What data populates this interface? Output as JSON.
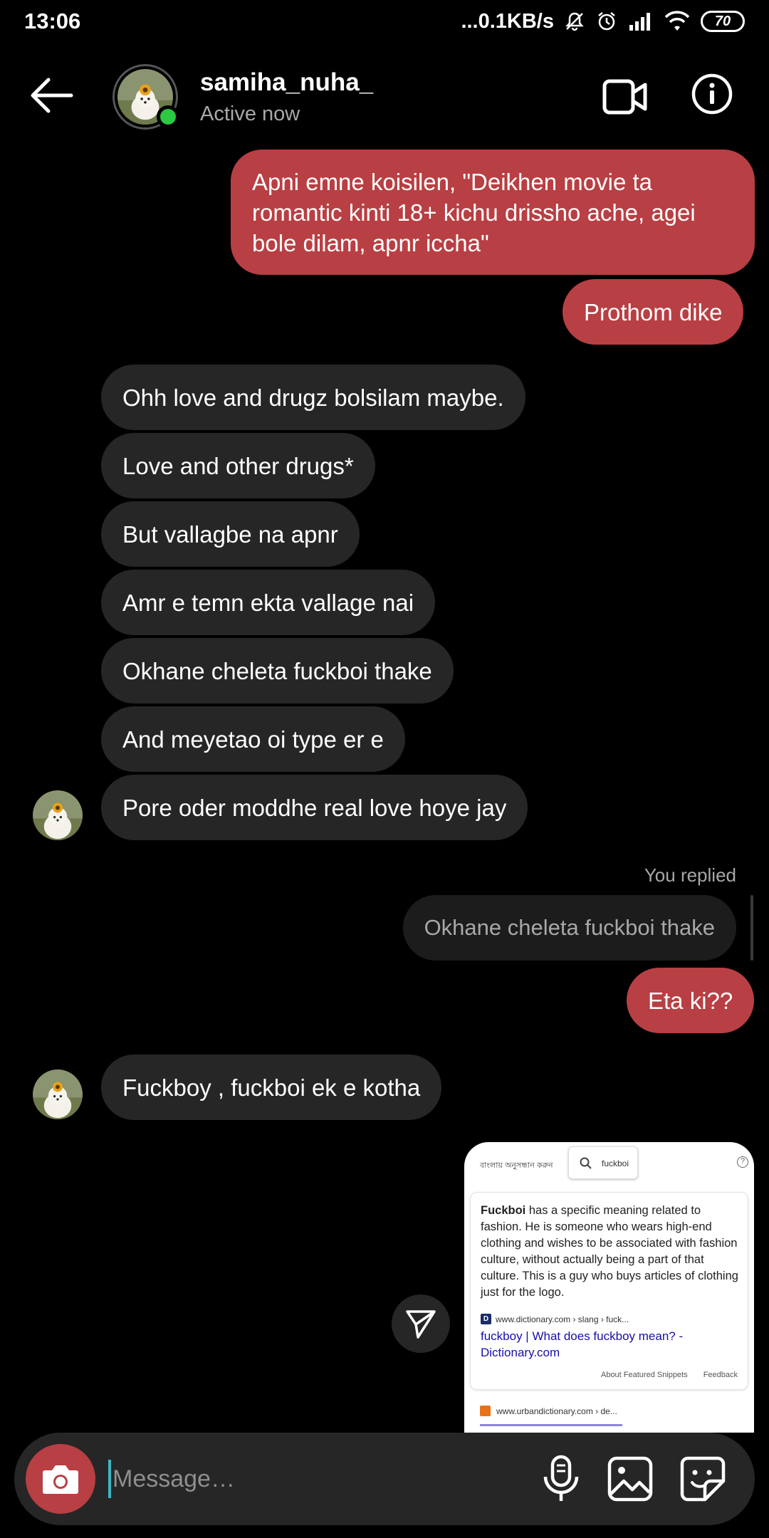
{
  "status_bar": {
    "time": "13:06",
    "net_speed": "...0.1KB/s",
    "battery": "70"
  },
  "header": {
    "username": "samiha_nuha_",
    "status": "Active now"
  },
  "messages": {
    "out1": "Apni emne koisilen, \"Deikhen movie ta romantic kinti 18+ kichu drissho ache, agei bole dilam, apnr iccha\"",
    "out2": "Prothom dike",
    "in1": "Ohh love and drugz bolsilam maybe.",
    "in2": "Love and other drugs*",
    "in3": "But vallagbe na apnr",
    "in4": "Amr e temn ekta vallage nai",
    "in5": "Okhane cheleta fuckboi thake",
    "in6": "And meyetao oi type er e",
    "in7": "Pore oder moddhe real love hoye jay",
    "you_replied": "You replied",
    "reply_quote": "Okhane cheleta fuckboi thake",
    "out3": "Eta ki??",
    "in8": "Fuckboy , fuckboi ek e kotha"
  },
  "shared_image": {
    "bangla_label": "বাংলায় অনুসন্ধান করুন",
    "search_query": "fuckboi",
    "definition_term": "Fuckboi",
    "definition_rest": " has a specific meaning related to fashion. He is someone who wears high-end clothing and wishes to be associated with fashion culture, without actually being a part of that culture. This is a guy who buys articles of clothing just for the logo.",
    "source": "www.dictionary.com › slang › fuck...",
    "link_title": "fuckboy | What does fuckboy mean? - Dictionary.com",
    "about": "About Featured Snippets",
    "feedback": "Feedback",
    "source2": "www.urbandictionary.com › de..."
  },
  "composer": {
    "placeholder": "Message…"
  },
  "colors": {
    "outgoing_bubble": "#b83f43",
    "incoming_bubble": "#262626",
    "online": "#2bc940",
    "background": "#000000"
  },
  "icons": [
    "back-arrow-icon",
    "video-call-icon",
    "info-icon",
    "camera-icon",
    "microphone-icon",
    "gallery-icon",
    "sticker-icon",
    "send-icon"
  ]
}
